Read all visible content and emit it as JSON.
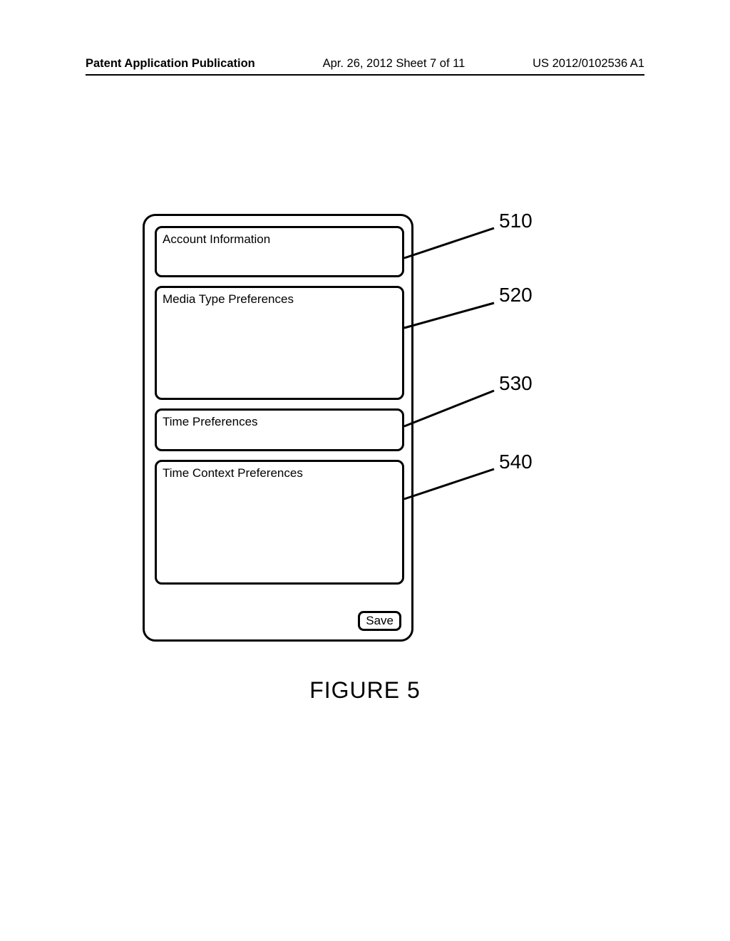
{
  "header": {
    "left": "Patent Application Publication",
    "center": "Apr. 26, 2012  Sheet 7 of 11",
    "right": "US 2012/0102536 A1"
  },
  "figure": {
    "caption": "FIGURE 5",
    "panel": {
      "boxes": {
        "b510": {
          "label": "Account Information",
          "ref": "510"
        },
        "b520": {
          "label": "Media Type Preferences",
          "ref": "520"
        },
        "b530": {
          "label": "Time Preferences",
          "ref": "530"
        },
        "b540": {
          "label": "Time Context Preferences",
          "ref": "540"
        }
      },
      "save_label": "Save"
    }
  }
}
